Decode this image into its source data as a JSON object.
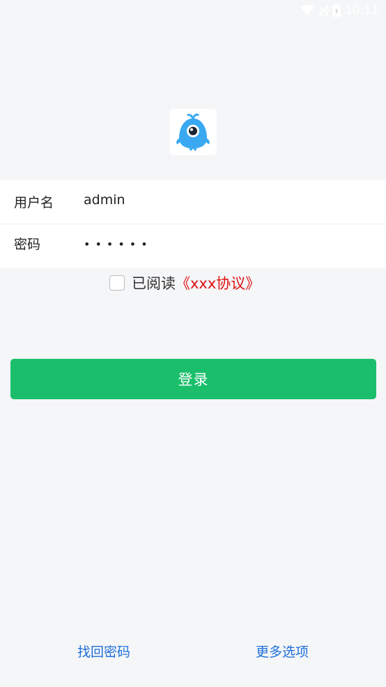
{
  "status_bar": {
    "time": "10:11",
    "icons": [
      "wifi-icon",
      "signal-icon",
      "battery-icon"
    ]
  },
  "app": {
    "logo": "app-logo",
    "accent_color": "#1bbf6b",
    "link_color": "#1e6fdc",
    "agreement_color": "#e01010"
  },
  "form": {
    "username_label": "用户名",
    "username_value": "admin",
    "password_label": "密码",
    "password_value": "••••••"
  },
  "agreement": {
    "prefix": "已阅读",
    "link": "《xxx协议》",
    "checked": false
  },
  "login_button": "登录",
  "bottom_links": {
    "forgot_password": "找回密码",
    "more_options": "更多选项"
  }
}
